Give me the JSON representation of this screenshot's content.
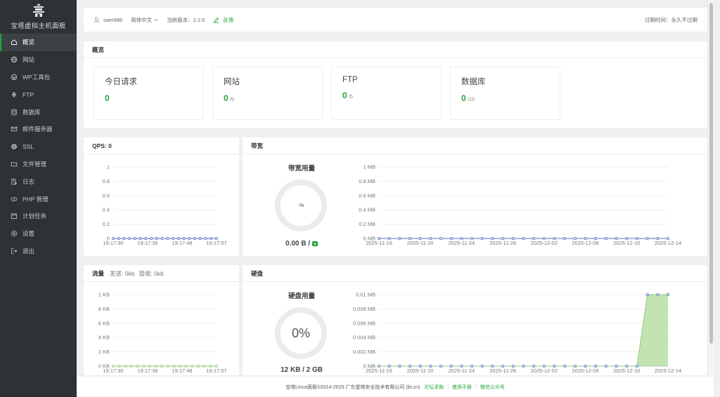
{
  "sidebar": {
    "brand": "宝塔虚拟主机面板",
    "items": [
      {
        "label": "概览",
        "icon": "home-icon",
        "active": true
      },
      {
        "label": "网站",
        "icon": "globe-icon"
      },
      {
        "label": "WP工具包",
        "icon": "wordpress-icon"
      },
      {
        "label": "FTP",
        "icon": "ftp-icon"
      },
      {
        "label": "数据库",
        "icon": "database-icon"
      },
      {
        "label": "邮件服务器",
        "icon": "mail-icon"
      },
      {
        "label": "SSL",
        "icon": "ssl-icon"
      },
      {
        "label": "文件管理",
        "icon": "folder-icon"
      },
      {
        "label": "日志",
        "icon": "log-icon"
      },
      {
        "label": "PHP 管理",
        "icon": "php-icon"
      },
      {
        "label": "计划任务",
        "icon": "calendar-icon"
      },
      {
        "label": "设置",
        "icon": "gear-icon"
      },
      {
        "label": "退出",
        "icon": "logout-icon"
      }
    ]
  },
  "topbar": {
    "username": "saer688",
    "language": "简体中文",
    "version_label": "当前版本：",
    "version": "2.2.6",
    "feedback": "反馈",
    "expire": "过期时间：永久不过期"
  },
  "overview": {
    "title": "概览",
    "stats": [
      {
        "label": "今日请求",
        "value": "0",
        "total": ""
      },
      {
        "label": "网站",
        "value": "0",
        "total": "/5"
      },
      {
        "label": "FTP",
        "value": "0",
        "total": "/5"
      },
      {
        "label": "数据库",
        "value": "0",
        "total": "/10"
      }
    ]
  },
  "qps": {
    "title": "QPS: 0"
  },
  "bandwidth": {
    "title": "带宽",
    "gauge_title": "带宽用量",
    "percent": "-%",
    "usage": "0.00 B /",
    "badge": "00"
  },
  "traffic": {
    "title": "流量",
    "sent": "发送: 0kb",
    "received": "接收: 0kb"
  },
  "disk": {
    "title": "硬盘",
    "gauge_title": "硬盘用量",
    "percent": "0%",
    "usage": "12 KB / 2 GB"
  },
  "footer": {
    "copyright": "宝塔Linux面板©2014-2025 广东堡塔安全技术有限公司 (bt.cn)",
    "links": [
      "论坛求助",
      "使用手册",
      "微信公众号"
    ]
  },
  "colors": {
    "accent": "#20a53a",
    "sidebar": "#2e3234",
    "qps_line": "#5470c6",
    "traffic_line": "#91cc75"
  },
  "chart_data": [
    {
      "type": "line",
      "name": "qps",
      "x": [
        "19:17:30",
        "19:17:39",
        "19:17:48",
        "19:17:57"
      ],
      "yticks": [
        "0",
        "0.2",
        "0.4",
        "0.6",
        "0.8",
        "1"
      ],
      "ylim": [
        0,
        1
      ],
      "values": [
        0,
        0,
        0,
        0,
        0,
        0,
        0,
        0,
        0,
        0,
        0,
        0,
        0,
        0,
        0,
        0,
        0,
        0,
        0,
        0
      ],
      "color": "#5470c6"
    },
    {
      "type": "line",
      "name": "bandwidth",
      "x": [
        "2025-11-16",
        "2025-11-20",
        "2025-11-24",
        "2025-11-28",
        "2025-12-02",
        "2025-12-06",
        "2025-12-10",
        "2025-12-14"
      ],
      "yticks": [
        "0 MB",
        "0.2 MB",
        "0.4 MB",
        "0.6 MB",
        "0.8 MB",
        "1 MB"
      ],
      "ylim": [
        0,
        1
      ],
      "values": [
        0,
        0,
        0,
        0,
        0,
        0,
        0,
        0,
        0,
        0,
        0,
        0,
        0,
        0,
        0,
        0,
        0,
        0,
        0,
        0,
        0,
        0,
        0,
        0,
        0,
        0,
        0,
        0,
        0
      ],
      "color": "#5470c6"
    },
    {
      "type": "line",
      "name": "traffic",
      "x": [
        "19:17:30",
        "19:17:39",
        "19:17:48",
        "19:17:57"
      ],
      "yticks": [
        "0 KB",
        "2 KB",
        "4 KB",
        "6 KB",
        "8 KB",
        "1 KB"
      ],
      "ylim": [
        0,
        1
      ],
      "values": [
        0,
        0,
        0,
        0,
        0,
        0,
        0,
        0,
        0,
        0,
        0,
        0,
        0,
        0,
        0,
        0,
        0,
        0
      ],
      "color": "#91cc75"
    },
    {
      "type": "area",
      "name": "disk",
      "x": [
        "2025-11-16",
        "2025-11-20",
        "2025-11-24",
        "2025-11-28",
        "2025-12-02",
        "2025-12-06",
        "2025-12-10",
        "2025-12-14"
      ],
      "yticks": [
        "0 MB",
        "0.002 MB",
        "0.004 MB",
        "0.006 MB",
        "0.008 MB",
        "0.01 MB"
      ],
      "ylim": [
        0,
        0.01
      ],
      "values": [
        0,
        0,
        0,
        0,
        0,
        0,
        0,
        0,
        0,
        0,
        0,
        0,
        0,
        0,
        0,
        0,
        0,
        0,
        0,
        0,
        0,
        0,
        0,
        0,
        0,
        0,
        0.01,
        0.01,
        0.01
      ],
      "color": "#5470c6",
      "fill": "#91cc75"
    }
  ]
}
